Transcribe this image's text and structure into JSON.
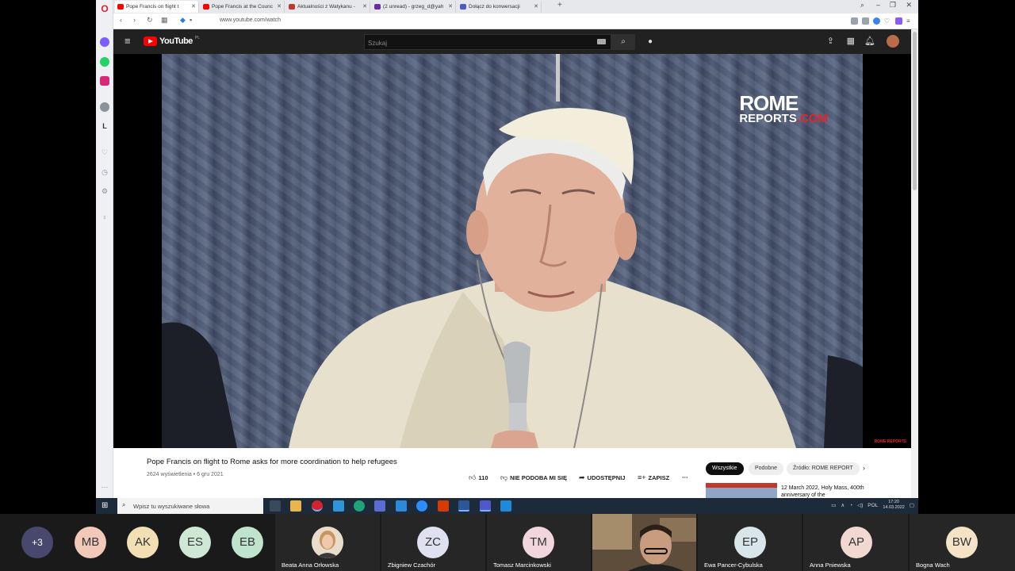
{
  "browser": {
    "tabs": [
      {
        "label": "Pope Francis on flight t",
        "favicon_color": "#ff0000",
        "active": true
      },
      {
        "label": "Pope Francis at the Counc",
        "favicon_color": "#ff0000",
        "active": false
      },
      {
        "label": "Aktualności z Watykanu -",
        "favicon_color": "#c0392b",
        "active": false
      },
      {
        "label": "(2 unread) - grzeg_d@yah",
        "favicon_color": "#6b2fa3",
        "active": false
      },
      {
        "label": "Dołącz do konwersacji",
        "favicon_color": "#5059c9",
        "active": false
      }
    ],
    "new_tab": "+",
    "url": "www.youtube.com/watch"
  },
  "youtube": {
    "logo_text": "YouTube",
    "country_code": "PL",
    "search_placeholder": "Szukaj",
    "video": {
      "title": "Pope Francis on flight to Rome asks for more coordination to help refugees",
      "meta": "2624 wyświetlenia • 6 gru 2021",
      "watermark_top": "ROME",
      "watermark_bottom": "REPORTS",
      "watermark_suffix": ".COM",
      "watermark_small": "ROME REPORTS"
    },
    "actions": {
      "likes": "110",
      "dislike": "NIE PODOBA MI SIĘ",
      "share": "UDOSTĘPNIJ",
      "save": "ZAPISZ",
      "more": "⋯"
    },
    "chips": [
      "Wszystkie",
      "Podobne",
      "Źródło: ROME REPORT"
    ],
    "related": {
      "title": "12 March 2022, Holy Mass, 400th anniversary of the"
    }
  },
  "taskbar": {
    "search_placeholder": "Wpisz tu wyszukiwane słowa",
    "language": "POL",
    "time": "17:20",
    "date": "14.03.2022"
  },
  "meeting": {
    "overflow": "+3",
    "avatars": [
      {
        "initials": "MB",
        "color": "#f0c9b8"
      },
      {
        "initials": "AK",
        "color": "#f3dfb4"
      },
      {
        "initials": "ES",
        "color": "#cfe8d6"
      },
      {
        "initials": "EB",
        "color": "#bfe3cc"
      }
    ],
    "named": [
      {
        "name": "Beata Anna Orłowska",
        "initials": "",
        "color": "#d9b8a0",
        "photo": true
      },
      {
        "name": "Zbigniew Czachór",
        "initials": "ZC",
        "color": "#dfe0f0"
      },
      {
        "name": "Tomasz  Marcinkowski",
        "initials": "TM",
        "color": "#f2d6de"
      },
      {
        "name": "",
        "initials": "",
        "color": "#6b5a45",
        "video": true
      },
      {
        "name": "Ewa Pancer-Cybulska",
        "initials": "EP",
        "color": "#d8e6ea"
      },
      {
        "name": "Anna Pniewska",
        "initials": "AP",
        "color": "#f1d9d2"
      },
      {
        "name": "Bogna Wach",
        "initials": "BW",
        "color": "#f5e3c8"
      }
    ]
  }
}
